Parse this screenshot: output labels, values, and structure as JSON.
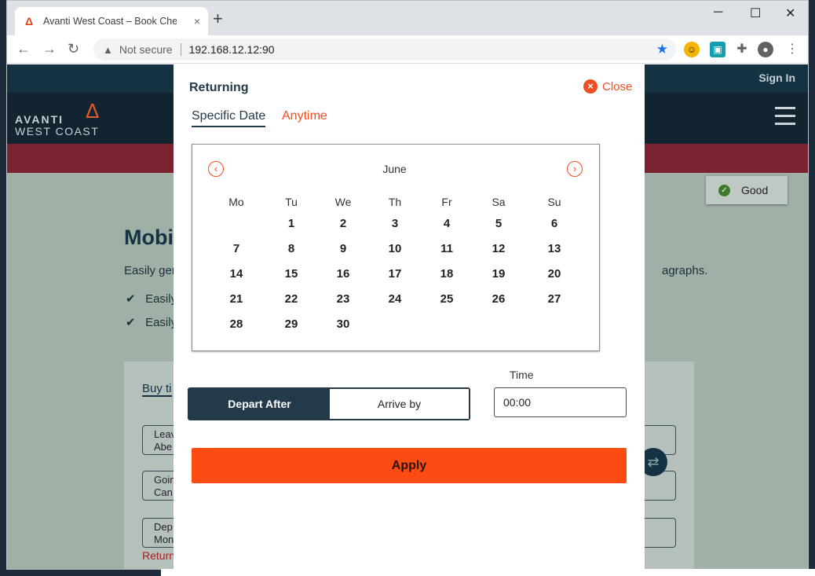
{
  "browser": {
    "tab_title": "Avanti West Coast – Book Cheap",
    "tab_close": "×",
    "new_tab": "+",
    "not_secure": "Not secure",
    "url": "192.168.12.12:90",
    "win_min": "─",
    "win_max": "☐",
    "win_close": "✕"
  },
  "site": {
    "sign_in": "Sign In",
    "logo_line1": "AVANTI",
    "logo_line2": "WEST COAST",
    "good_label": "Good",
    "bg_heading": "Mobi",
    "bg_para_left": "Easily gen",
    "bg_para_right": "agraphs.",
    "bg_list": [
      "Easily",
      "Easily"
    ],
    "bg_buy_tab": "Buy ti",
    "bg_fields": [
      {
        "label": "Leav",
        "value": "Abe"
      },
      {
        "label": "Goin",
        "value": "Can"
      },
      {
        "label": "Dep",
        "value": "Mon"
      }
    ],
    "bg_return": "Return"
  },
  "modal": {
    "title": "Returning",
    "close": "Close",
    "tab_specific": "Specific Date",
    "tab_anytime": "Anytime",
    "month": "June",
    "weekdays": [
      "Mo",
      "Tu",
      "We",
      "Th",
      "Fr",
      "Sa",
      "Su"
    ],
    "weeks": [
      [
        "",
        "1",
        "2",
        "3",
        "4",
        "5",
        "6"
      ],
      [
        "7",
        "8",
        "9",
        "10",
        "11",
        "12",
        "13"
      ],
      [
        "14",
        "15",
        "16",
        "17",
        "18",
        "19",
        "20"
      ],
      [
        "21",
        "22",
        "23",
        "24",
        "25",
        "26",
        "27"
      ],
      [
        "28",
        "29",
        "30",
        "",
        "",
        "",
        ""
      ]
    ],
    "time_label": "Time",
    "depart_after": "Depart After",
    "arrive_by": "Arrive by",
    "time_value": "00:00",
    "apply": "Apply"
  },
  "colors": {
    "accent": "#f04e23",
    "navy": "#223a4a",
    "apply_bg": "#fc4c13"
  }
}
